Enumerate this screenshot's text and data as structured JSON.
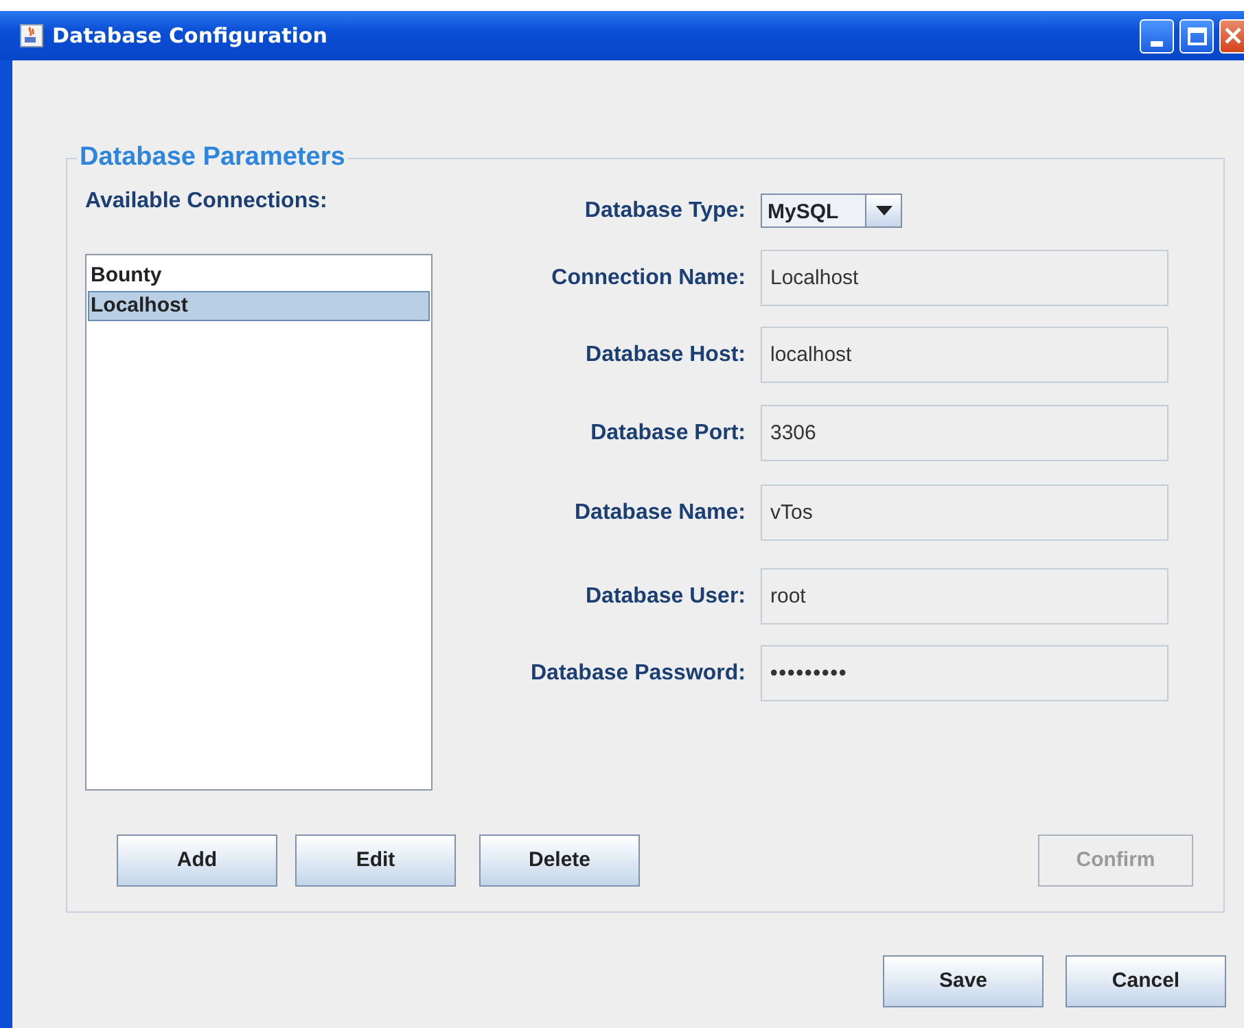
{
  "window": {
    "title": "Database Configuration"
  },
  "panel": {
    "legend": "Database Parameters",
    "connections": {
      "label": "Available Connections:",
      "items": [
        {
          "label": "Bounty",
          "selected": false
        },
        {
          "label": "Localhost",
          "selected": true
        }
      ]
    },
    "fields": [
      {
        "kind": "select",
        "label": "Database Type:",
        "value": "MySQL"
      },
      {
        "kind": "text",
        "label": "Connection Name:",
        "value": "Localhost"
      },
      {
        "kind": "text",
        "label": "Database Host:",
        "value": "localhost"
      },
      {
        "kind": "text",
        "label": "Database Port:",
        "value": "3306"
      },
      {
        "kind": "text",
        "label": "Database Name:",
        "value": "vTos"
      },
      {
        "kind": "text",
        "label": "Database User:",
        "value": "root"
      },
      {
        "kind": "password",
        "label": "Database Password:",
        "value": "•••••••••"
      }
    ],
    "buttons": [
      {
        "label": "Add",
        "disabled": false
      },
      {
        "label": "Edit",
        "disabled": false
      },
      {
        "label": "Delete",
        "disabled": false
      },
      {
        "label": "Confirm",
        "disabled": true
      }
    ]
  },
  "dialog_buttons": [
    {
      "label": "Save",
      "disabled": false
    },
    {
      "label": "Cancel",
      "disabled": false
    }
  ]
}
